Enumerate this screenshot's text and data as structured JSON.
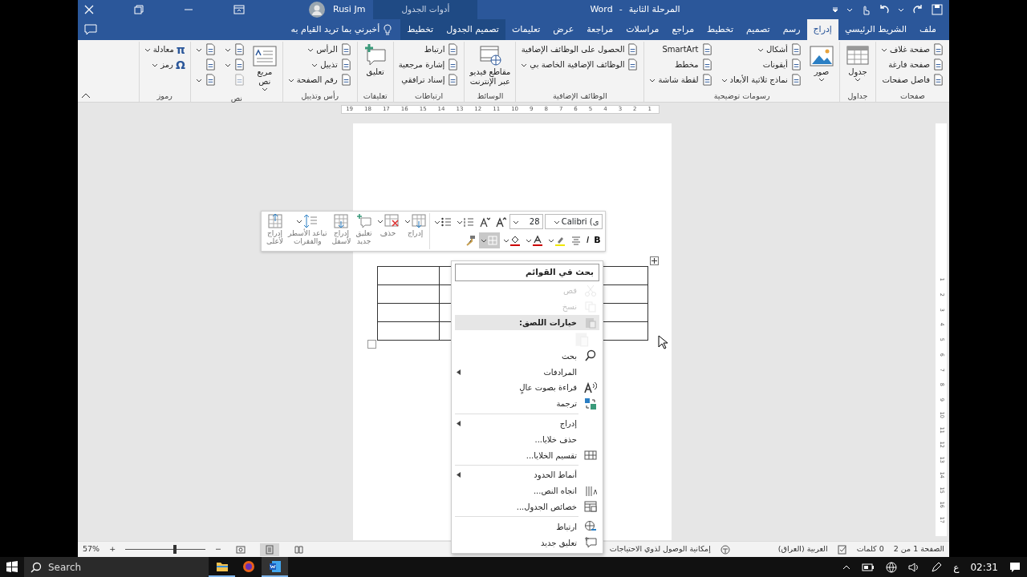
{
  "title_bar": {
    "document": "المرحلة الثانية",
    "separator": "-",
    "app": "Word",
    "user": "Rusi Jm",
    "contextual_label": "أدوات الجدول"
  },
  "tabs": [
    {
      "label": "ملف",
      "selected": false,
      "contextual": false
    },
    {
      "label": "الشريط الرئيسي",
      "selected": false,
      "contextual": false
    },
    {
      "label": "إدراج",
      "selected": true,
      "contextual": false
    },
    {
      "label": "رسم",
      "selected": false,
      "contextual": false
    },
    {
      "label": "تصميم",
      "selected": false,
      "contextual": false
    },
    {
      "label": "تخطيط",
      "selected": false,
      "contextual": false
    },
    {
      "label": "مراجع",
      "selected": false,
      "contextual": false
    },
    {
      "label": "مراسلات",
      "selected": false,
      "contextual": false
    },
    {
      "label": "مراجعة",
      "selected": false,
      "contextual": false
    },
    {
      "label": "عرض",
      "selected": false,
      "contextual": false
    },
    {
      "label": "تعليمات",
      "selected": false,
      "contextual": false
    },
    {
      "label": "تصميم الجدول",
      "selected": false,
      "contextual": true
    },
    {
      "label": "تخطيط",
      "selected": false,
      "contextual": true
    }
  ],
  "tell_me": "أخبرني بما تريد القيام به",
  "ribbon_groups": [
    {
      "label": "صفحات",
      "items": [
        {
          "label": "صفحة غلاف",
          "kind": "small",
          "dropdown": true
        },
        {
          "label": "صفحة فارغة",
          "kind": "small",
          "dropdown": false
        },
        {
          "label": "فاصل صفحات",
          "kind": "small",
          "dropdown": false
        }
      ]
    },
    {
      "label": "جداول",
      "items": [
        {
          "label": "جدول",
          "kind": "large",
          "dropdown": true
        }
      ]
    },
    {
      "label": "رسومات توضيحية",
      "items": [
        {
          "label": "صور",
          "kind": "large",
          "dropdown": true
        },
        {
          "label": "أشكال",
          "kind": "small",
          "dropdown": true
        },
        {
          "label": "أيقونات",
          "kind": "small",
          "dropdown": false
        },
        {
          "label": "نماذج ثلاثية الأبعاد",
          "kind": "small",
          "dropdown": true
        },
        {
          "label": "SmartArt",
          "kind": "small",
          "dropdown": false
        },
        {
          "label": "مخطط",
          "kind": "small",
          "dropdown": false
        },
        {
          "label": "لقطة شاشة",
          "kind": "small",
          "dropdown": true
        }
      ]
    },
    {
      "label": "الوظائف الإضافية",
      "items": [
        {
          "label": "الحصول على الوظائف الإضافية",
          "kind": "small",
          "dropdown": false
        },
        {
          "label": "الوظائف الإضافية الخاصة بي",
          "kind": "small",
          "dropdown": true
        }
      ]
    },
    {
      "label": "الوسائط",
      "items": [
        {
          "label": "مقاطع فيديو\nعبر الإنترنت",
          "kind": "large",
          "dropdown": false
        }
      ]
    },
    {
      "label": "ارتباطات",
      "items": [
        {
          "label": "ارتباط",
          "kind": "small",
          "dropdown": false
        },
        {
          "label": "إشارة مرجعية",
          "kind": "small",
          "dropdown": false
        },
        {
          "label": "إسناد ترافقي",
          "kind": "small",
          "dropdown": false
        }
      ]
    },
    {
      "label": "تعليقات",
      "items": [
        {
          "label": "تعليق",
          "kind": "large",
          "dropdown": false
        }
      ]
    },
    {
      "label": "رأس وتذييل",
      "items": [
        {
          "label": "الرأس",
          "kind": "small",
          "dropdown": true
        },
        {
          "label": "تذييل",
          "kind": "small",
          "dropdown": true
        },
        {
          "label": "رقم الصفحة",
          "kind": "small",
          "dropdown": true
        }
      ]
    },
    {
      "label": "نص",
      "items": [
        {
          "label": "مربع\nنص",
          "kind": "large",
          "dropdown": true
        },
        {
          "kind": "icon",
          "dropdown": true,
          "disabled": false
        },
        {
          "kind": "icon",
          "dropdown": true,
          "disabled": false
        },
        {
          "kind": "icon",
          "dropdown": false,
          "disabled": true
        },
        {
          "kind": "icon",
          "dropdown": true,
          "disabled": false
        },
        {
          "kind": "icon",
          "dropdown": false,
          "disabled": false
        },
        {
          "kind": "icon",
          "dropdown": true,
          "disabled": false
        }
      ]
    },
    {
      "label": "رموز",
      "items": [
        {
          "label": "معادلة",
          "kind": "small",
          "glyph": "π",
          "dropdown": true
        },
        {
          "label": "رمز",
          "kind": "small",
          "glyph": "Ω",
          "dropdown": true
        }
      ]
    }
  ],
  "ruler": {
    "labels": [
      "1",
      "2",
      "3",
      "4",
      "5",
      "6",
      "7",
      "8",
      "9",
      "10",
      "11",
      "12",
      "13",
      "14",
      "15",
      "16",
      "17",
      "18",
      "19"
    ]
  },
  "vertical_ruler": {
    "labels": [
      "1",
      "2",
      "3",
      "4",
      "5",
      "6",
      "7",
      "8",
      "9",
      "10",
      "11",
      "12",
      "13",
      "14",
      "15",
      "16",
      "17"
    ]
  },
  "mini_toolbar": {
    "font": "Calibri (ى",
    "size": "28",
    "bold": "B",
    "italic": "I",
    "borders_selected": true,
    "buttons": [
      {
        "label": "إدراج",
        "dropdown": true
      },
      {
        "label": "حذف",
        "dropdown": true
      },
      {
        "label": "تعليق\nجديد",
        "dropdown": false
      },
      {
        "label": "إدراج\nلأسفل",
        "dropdown": false
      },
      {
        "label": "تباعد الأسطر\nوالفقرات",
        "dropdown": true
      },
      {
        "label": "إدراج\nلأعلى",
        "dropdown": false
      }
    ]
  },
  "context_menu": {
    "search": "بحث في القوائم",
    "items": [
      {
        "kind": "item",
        "label": "قص",
        "disabled": true,
        "submenu": false,
        "highlighted": false
      },
      {
        "kind": "item",
        "label": "نسخ",
        "disabled": true,
        "submenu": false,
        "highlighted": false
      },
      {
        "kind": "header",
        "label": "خيارات اللصق:",
        "disabled": false,
        "submenu": false,
        "highlighted": true
      },
      {
        "kind": "icon_row",
        "disabled": true,
        "submenu": false,
        "highlighted": false
      },
      {
        "kind": "item",
        "label": "بحث",
        "disabled": false,
        "submenu": false,
        "highlighted": false
      },
      {
        "kind": "item",
        "label": "المرادفات",
        "disabled": false,
        "submenu": true,
        "highlighted": false
      },
      {
        "kind": "item",
        "label": "قراءة بصوت عالٍ",
        "disabled": false,
        "submenu": false,
        "highlighted": false
      },
      {
        "kind": "item",
        "label": "ترجمة",
        "disabled": false,
        "submenu": false,
        "highlighted": false
      },
      {
        "kind": "separator"
      },
      {
        "kind": "item",
        "label": "إدراج",
        "disabled": false,
        "submenu": true,
        "highlighted": false
      },
      {
        "kind": "item",
        "label": "حذف خلايا...",
        "disabled": false,
        "submenu": false,
        "highlighted": false
      },
      {
        "kind": "item",
        "label": "تقسيم الخلايا...",
        "disabled": false,
        "submenu": false,
        "highlighted": false
      },
      {
        "kind": "separator"
      },
      {
        "kind": "item",
        "label": "أنماط الحدود",
        "disabled": false,
        "submenu": true,
        "highlighted": false
      },
      {
        "kind": "item",
        "label": "اتجاه النص...",
        "disabled": false,
        "submenu": false,
        "highlighted": false
      },
      {
        "kind": "item",
        "label": "خصائص الجدول...",
        "disabled": false,
        "submenu": false,
        "highlighted": false
      },
      {
        "kind": "separator"
      },
      {
        "kind": "item",
        "label": "ارتباط",
        "disabled": false,
        "submenu": false,
        "highlighted": false
      },
      {
        "kind": "item",
        "label": "تعليق جديد",
        "disabled": false,
        "submenu": false,
        "highlighted": false
      }
    ]
  },
  "status_bar": {
    "page": "الصفحة 1 من 2",
    "words": "0 كلمات",
    "language": "العربية (العراق)",
    "accessibility": "إمكانية الوصول لذوي الاحتياجات",
    "views": [
      {
        "selected": false
      },
      {
        "selected": true
      },
      {
        "selected": false
      }
    ],
    "zoom": {
      "minus": "−",
      "plus": "+",
      "level": 0.6,
      "percent": "57%"
    }
  },
  "taskbar": {
    "search_placeholder": "Search",
    "apps": [
      {
        "running": true,
        "active": false
      },
      {
        "running": false,
        "active": false
      },
      {
        "running": true,
        "active": true
      }
    ],
    "input_language": "ع",
    "time": "02:31"
  }
}
